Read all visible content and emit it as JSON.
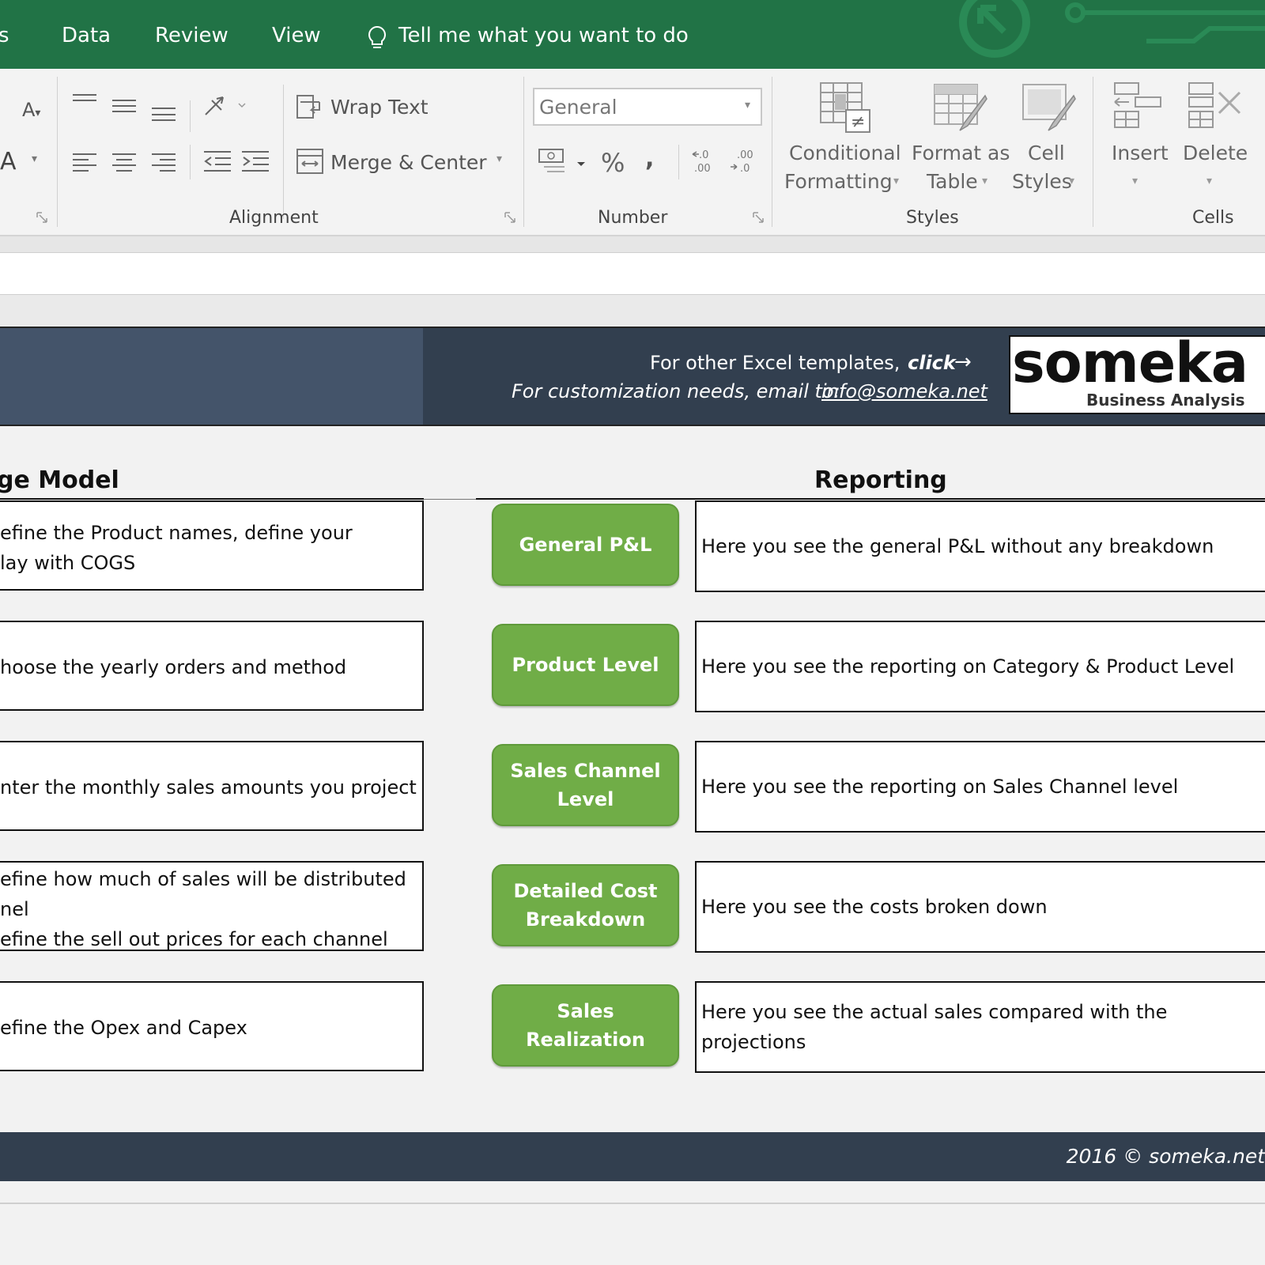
{
  "ribbon_tabs": {
    "partial_tab": "s",
    "data": "Data",
    "review": "Review",
    "view": "View",
    "tell_me": "Tell me what you want to do"
  },
  "ribbon": {
    "wrap_text": "Wrap Text",
    "merge_center": "Merge & Center",
    "number_format_value": "General",
    "percent": "%",
    "comma": ",",
    "conditional_formatting": [
      "Conditional",
      "Formatting"
    ],
    "format_as_table": [
      "Format as",
      "Table"
    ],
    "cell_styles": [
      "Cell",
      "Styles"
    ],
    "insert": "Insert",
    "delete": "Delete",
    "groups": {
      "alignment": "Alignment",
      "number": "Number",
      "styles": "Styles",
      "cells": "Cells"
    }
  },
  "banner": {
    "templates_text": "For other Excel templates,",
    "click_text": "click",
    "custom_text": "For customization needs, email to:",
    "email": "info@someka.net",
    "logo_text": "someka",
    "logo_sub": "Business Analysis"
  },
  "sections": {
    "left_title": "ge Model",
    "right_title": "Reporting"
  },
  "rows": [
    {
      "left_lines": [
        "efine the Product names, define your",
        "lay with COGS"
      ],
      "button": "General P&L",
      "right_text": "Here you see the general P&L without any breakdown"
    },
    {
      "left_lines": [
        "hoose the yearly orders and method"
      ],
      "button": "Product Level",
      "right_text": "Here you see the reporting on Category & Product Level"
    },
    {
      "left_lines": [
        "nter the monthly sales amounts you project"
      ],
      "button": "Sales Channel Level",
      "right_text": "Here you see the reporting on Sales Channel level"
    },
    {
      "left_lines": [
        "efine how much of sales will be distributed",
        "nel",
        "efine the sell out prices for each channel"
      ],
      "button": "Detailed Cost Breakdown",
      "right_text": "Here you see the costs broken down"
    },
    {
      "left_lines": [
        "efine the Opex and Capex"
      ],
      "button": "Sales Realization",
      "right_text": "Here you see the actual sales compared with the\nprojections"
    }
  ],
  "footer": {
    "copyright": "2016 © someka.net"
  }
}
